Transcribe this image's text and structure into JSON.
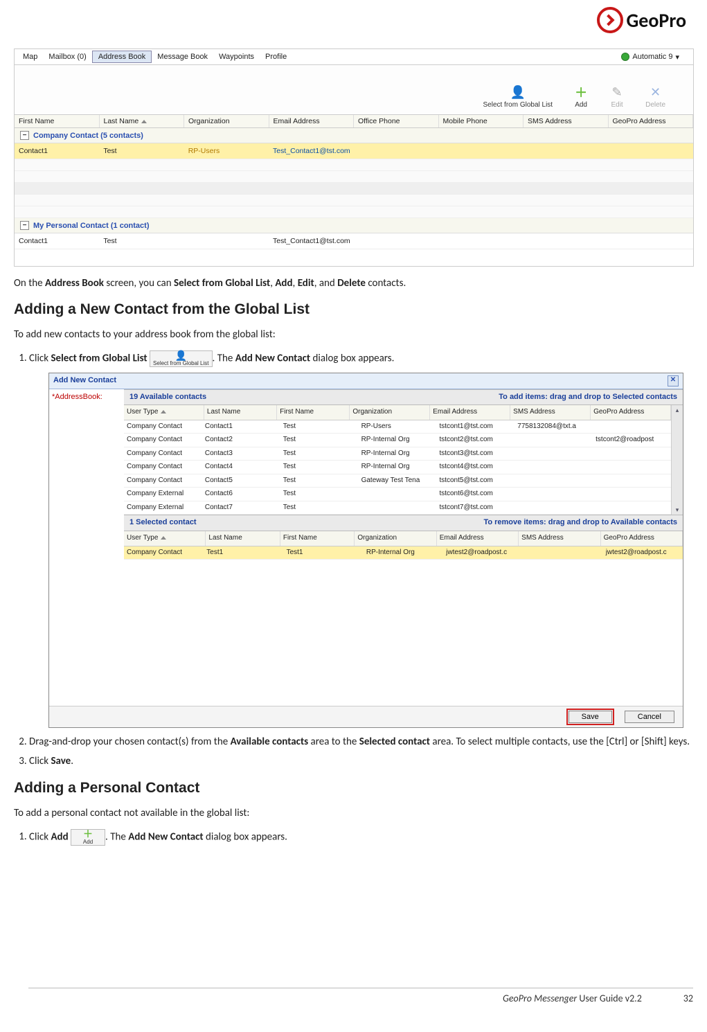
{
  "logo": {
    "text": "GeoPro"
  },
  "app1": {
    "menu": {
      "items": [
        "Map",
        "Mailbox (0)",
        "Address Book",
        "Message Book",
        "Waypoints",
        "Profile"
      ],
      "active_index": 2,
      "status_label": "Automatic 9"
    },
    "toolbar": {
      "select_global": "Select from Global List",
      "add": "Add",
      "edit": "Edit",
      "delete": "Delete"
    },
    "columns": [
      "First Name",
      "Last Name",
      "Organization",
      "Email Address",
      "Office Phone",
      "Mobile Phone",
      "SMS Address",
      "GeoPro Address"
    ],
    "group1": {
      "title": "Company Contact (5 contacts)",
      "rows": [
        {
          "first": "Contact1",
          "last": "Test",
          "org": "RP-Users",
          "email": "Test_Contact1@tst.com"
        }
      ]
    },
    "group2": {
      "title": "My Personal Contact (1 contact)",
      "rows": [
        {
          "first": "Contact1",
          "last": "Test",
          "org": "",
          "email": "Test_Contact1@tst.com"
        }
      ]
    }
  },
  "para1": {
    "t1": "On the ",
    "b1": "Address Book",
    "t2": " screen, you can ",
    "b2": "Select from Global List",
    "t3": ", ",
    "b3": "Add",
    "t4": ", ",
    "b4": "Edit",
    "t5": ", and ",
    "b5": "Delete",
    "t6": " contacts."
  },
  "h2a": "Adding a New Contact from the Global List",
  "intro_a": "To add new contacts to your address book from the global list:",
  "step_a1": {
    "pre": "Click ",
    "bold": "Select from Global List",
    "btn_label": "Select from Global List",
    "post1": ". The ",
    "bold2": "Add New Contact",
    "post2": " dialog box appears."
  },
  "dialog": {
    "title": "Add New Contact",
    "field_label": "*AddressBook:",
    "avail_header_left": "19 Available contacts",
    "avail_header_right": "To add items: drag and drop to Selected contacts",
    "columns": [
      "User Type",
      "Last Name",
      "First Name",
      "Organization",
      "Email Address",
      "SMS Address",
      "GeoPro Address"
    ],
    "avail_rows": [
      {
        "ut": "Company Contact",
        "ln": "Contact1",
        "fn": "Test",
        "org": "RP-Users",
        "em": "tstcont1@tst.com",
        "sms": "7758132084@txt.a",
        "gp": ""
      },
      {
        "ut": "Company Contact",
        "ln": "Contact2",
        "fn": "Test",
        "org": "RP-Internal Org",
        "em": "tstcont2@tst.com",
        "sms": "",
        "gp": "tstcont2@roadpost"
      },
      {
        "ut": "Company Contact",
        "ln": "Contact3",
        "fn": "Test",
        "org": "RP-Internal Org",
        "em": "tstcont3@tst.com",
        "sms": "",
        "gp": ""
      },
      {
        "ut": "Company Contact",
        "ln": "Contact4",
        "fn": "Test",
        "org": "RP-Internal Org",
        "em": "tstcont4@tst.com",
        "sms": "",
        "gp": ""
      },
      {
        "ut": "Company Contact",
        "ln": "Contact5",
        "fn": "Test",
        "org": "Gateway Test Tena",
        "em": "tstcont5@tst.com",
        "sms": "",
        "gp": ""
      },
      {
        "ut": "Company External",
        "ln": "Contact6",
        "fn": "Test",
        "org": "",
        "em": "tstcont6@tst.com",
        "sms": "",
        "gp": ""
      },
      {
        "ut": "Company External",
        "ln": "Contact7",
        "fn": "Test",
        "org": "",
        "em": "tstcont7@tst.com",
        "sms": "",
        "gp": ""
      }
    ],
    "sel_header_left": "1 Selected contact",
    "sel_header_right": "To remove items: drag and drop to Available contacts",
    "sel_rows": [
      {
        "ut": "Company Contact",
        "ln": "Test1",
        "fn": "Test1",
        "org": "RP-Internal Org",
        "em": "jwtest2@roadpost.c",
        "sms": "",
        "gp": "jwtest2@roadpost.c"
      }
    ],
    "save": "Save",
    "cancel": "Cancel"
  },
  "step_a2": {
    "pre": "Drag-and-drop your chosen contact(s) from the ",
    "b1": "Available contacts",
    "mid": " area to the ",
    "b2": "Selected contact",
    "post": " area. To select multiple contacts, use the [Ctrl] or [Shift] keys."
  },
  "step_a3": {
    "pre": "Click ",
    "b": "Save",
    "post": "."
  },
  "h2b": "Adding a Personal Contact",
  "intro_b": "To add a personal contact not available in the global list:",
  "step_b1": {
    "pre": "Click ",
    "b1": "Add",
    "btn_label": "Add",
    "post1": ". The ",
    "b2": "Add New Contact",
    "post2": " dialog box appears."
  },
  "footer": {
    "title_italic": "GeoPro Messenger ",
    "title_plain": "User Guide v2.2",
    "page": "32"
  }
}
